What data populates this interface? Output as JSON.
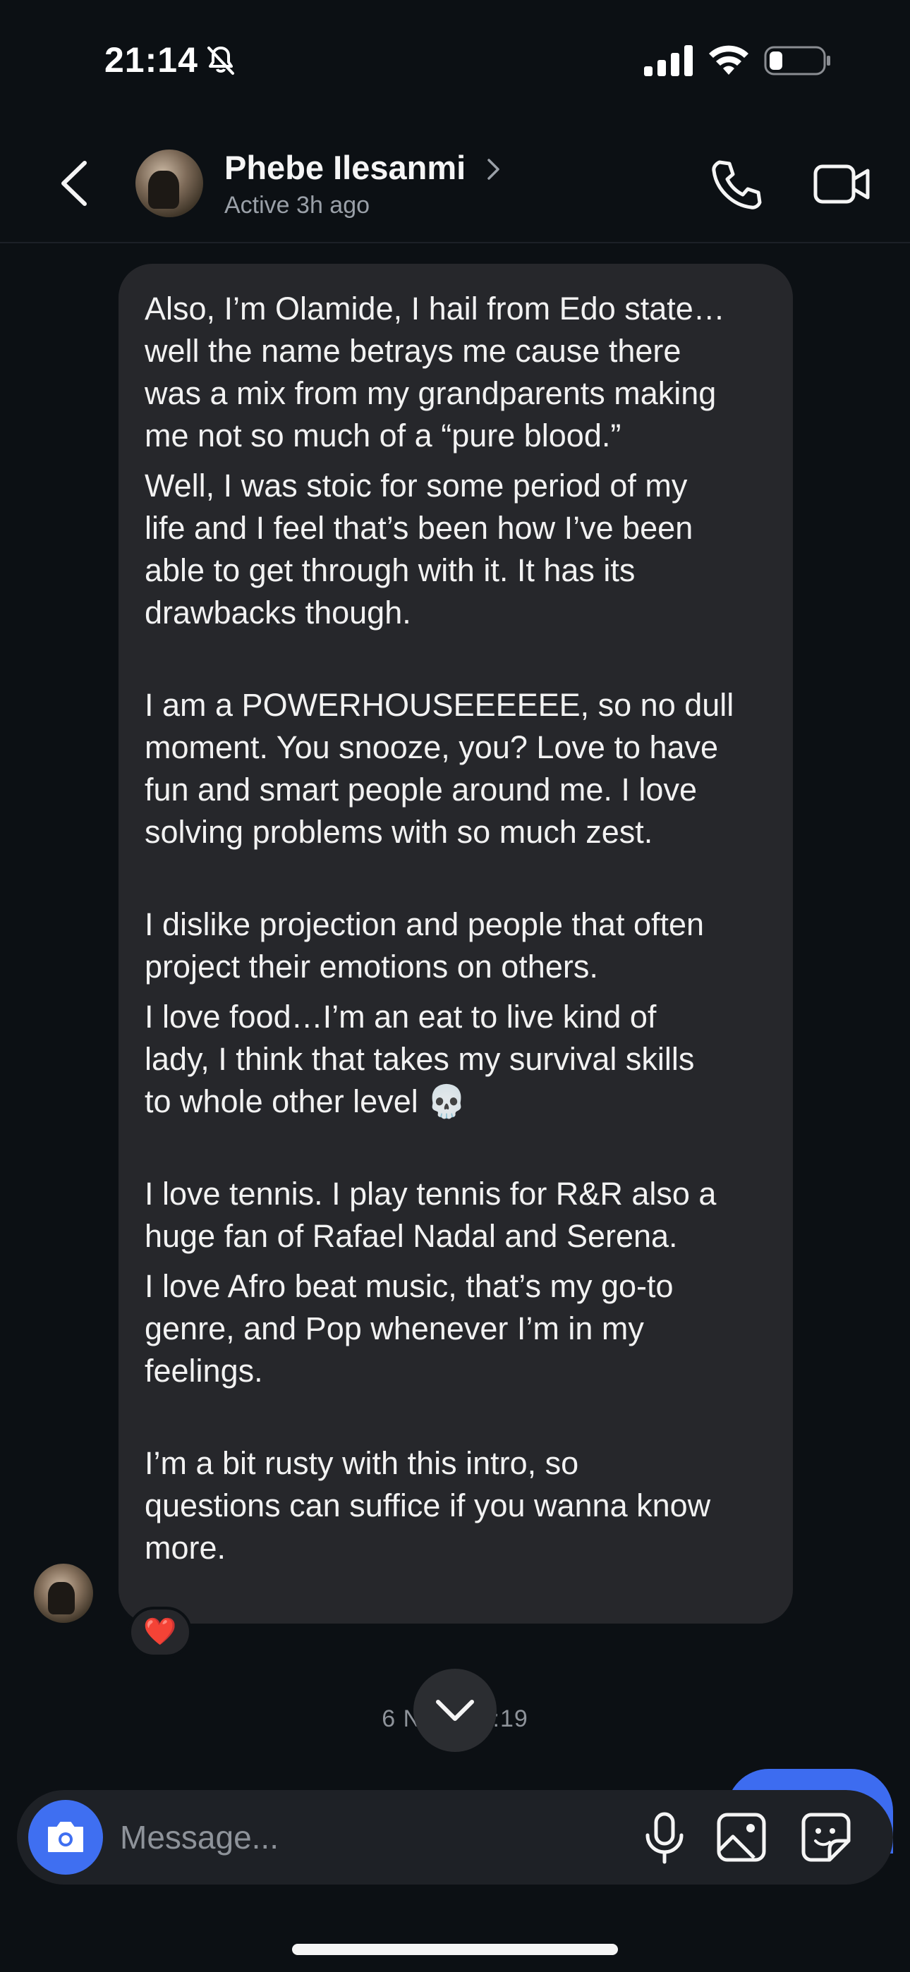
{
  "status_bar": {
    "time": "21:14"
  },
  "header": {
    "contact_name": "Phebe Ilesanmi",
    "contact_status": "Active 3h ago"
  },
  "message": {
    "paragraphs": [
      "Also, I’m Olamide, I hail from Edo state…\nwell the name betrays me cause there\nwas a mix from my grandparents making\nme not so much of a “pure blood.”",
      "Well, I was stoic for some period of my\nlife and I feel that’s been how I’ve been\nable to get through with it. It has its\ndrawbacks though.",
      "I am a POWERHOUSEEEEEE, so no dull\nmoment. You snooze, you? Love to have\nfun and smart people around me. I love\nsolving problems with so much zest.",
      "I dislike projection and people that often\nproject their emotions on others.",
      "I love food…I’m an eat to live kind of\nlady, I think that takes my survival skills\nto whole other level 💀",
      "I love tennis. I play tennis for R&R also a\nhuge fan of Rafael Nadal and Serena.",
      "I love Afro beat music, that’s my go-to\ngenre, and Pop whenever I’m in my\nfeelings.",
      "I’m a bit rusty with this intro, so\nquestions can suffice if you wanna know\nmore."
    ],
    "reaction": "❤️"
  },
  "timestamp": "6 NOV 06:19",
  "composer": {
    "placeholder": "Message..."
  },
  "icons": {
    "back": "chevron-left-icon",
    "call": "phone-icon",
    "video": "video-camera-icon",
    "camera": "camera-icon",
    "mic": "microphone-icon",
    "gallery": "image-icon",
    "sticker": "sticker-icon",
    "scroll_down": "chevron-down-icon"
  },
  "colors": {
    "background": "#0c1014",
    "bubble": "#26272b",
    "accent_blue": "#3f6ff1",
    "secondary_text": "#9aa0a8"
  }
}
